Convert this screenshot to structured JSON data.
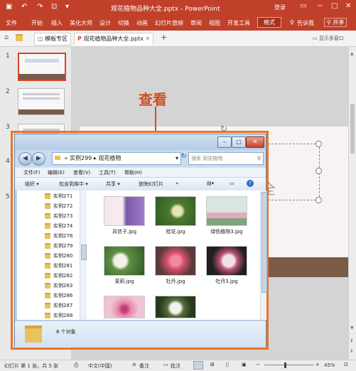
{
  "powerpoint": {
    "title": "观花植物品种大全.pptx - PowerPoint",
    "login": "登录",
    "quick_access": [
      "save-icon",
      "undo-icon",
      "redo-icon",
      "present-icon"
    ],
    "ribbon_tabs": [
      "文件",
      "开始",
      "插入",
      "美化大师",
      "设计",
      "切换",
      "动画",
      "幻灯片放映",
      "审阅",
      "视图",
      "开发工具",
      "格式"
    ],
    "active_tab": "格式",
    "tell_me": "告诉我",
    "share": "共享",
    "doc_tabs": [
      "模板专区",
      "观花植物品种大全.pptx"
    ],
    "multi_window": "显示多窗口",
    "slide_numbers": [
      "1",
      "2",
      "3",
      "4",
      "5"
    ],
    "slide_text_partial": "全",
    "status": {
      "slide_info": "幻灯片 第 1 张，共 5 张",
      "language": "中文(中国)",
      "notes": "备注",
      "comments": "批注",
      "zoom": "45%"
    }
  },
  "annotation": {
    "label": "查看",
    "color": "#d24e20"
  },
  "explorer": {
    "breadcrumb": [
      "实例299",
      "观花植物"
    ],
    "search_placeholder": "搜索 观花植物",
    "menu": [
      "文件(F)",
      "编辑(E)",
      "查看(V)",
      "工具(T)",
      "帮助(H)"
    ],
    "commands": [
      "组织 ▾",
      "包含到库中 ▾",
      "共享 ▾",
      "放映幻灯片",
      "»"
    ],
    "nav_items": [
      "实例271",
      "实例272",
      "实例273",
      "实例274",
      "实例278",
      "实例279",
      "实例280",
      "实例281",
      "实例282",
      "实例283",
      "实例286",
      "实例287",
      "实例288"
    ],
    "files": [
      {
        "name": "风信子.jpg",
        "colors": [
          "#f6e9ef",
          "#8d63b5",
          "#6c8b4b"
        ]
      },
      {
        "name": "桂花.jpg",
        "colors": [
          "#2f5a23",
          "#e7e3b8",
          "#4b7a2f"
        ]
      },
      {
        "name": "绿色植物3.jpg",
        "colors": [
          "#cfe0d8",
          "#e2a9c0",
          "#7fa37c"
        ]
      },
      {
        "name": "茉莉.jpg",
        "colors": [
          "#2e5a28",
          "#f3f1e8",
          "#5f8f43"
        ]
      },
      {
        "name": "牡丹.jpg",
        "colors": [
          "#5a3a3a",
          "#d8516a",
          "#f08aa0"
        ]
      },
      {
        "name": "牡丹3.jpg",
        "colors": [
          "#1f1f1f",
          "#f1e2e8",
          "#b9527a"
        ]
      },
      {
        "name": "",
        "colors": [
          "#f0c3d6",
          "#c23d78",
          "#e887ad"
        ]
      },
      {
        "name": "",
        "colors": [
          "#263a20",
          "#f4f4ee",
          "#556f3b"
        ]
      }
    ],
    "item_count": "8 个对象"
  }
}
